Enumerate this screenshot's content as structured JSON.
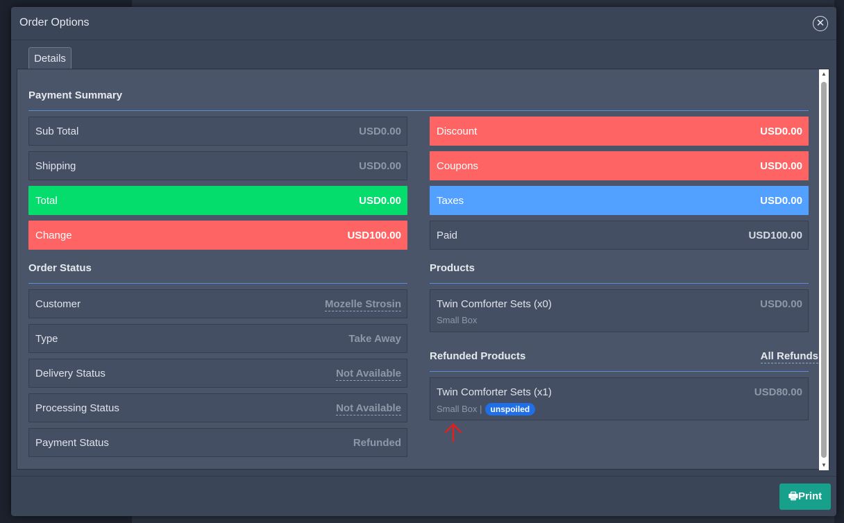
{
  "modal": {
    "title": "Order Options",
    "tab": "Details",
    "print_label": "Print"
  },
  "payment_summary": {
    "title": "Payment Summary",
    "left": [
      {
        "label": "Sub Total",
        "value": "USD0.00"
      },
      {
        "label": "Shipping",
        "value": "USD0.00"
      },
      {
        "label": "Total",
        "value": "USD0.00"
      },
      {
        "label": "Change",
        "value": "USD100.00"
      }
    ],
    "right": [
      {
        "label": "Discount",
        "value": "USD0.00"
      },
      {
        "label": "Coupons",
        "value": "USD0.00"
      },
      {
        "label": "Taxes",
        "value": "USD0.00"
      },
      {
        "label": "Paid",
        "value": "USD100.00"
      }
    ]
  },
  "order_status": {
    "title": "Order Status",
    "rows": [
      {
        "label": "Customer",
        "value": "Mozelle Strosin"
      },
      {
        "label": "Type",
        "value": "Take Away"
      },
      {
        "label": "Delivery Status",
        "value": "Not Available"
      },
      {
        "label": "Processing Status",
        "value": "Not Available"
      },
      {
        "label": "Payment Status",
        "value": "Refunded"
      }
    ]
  },
  "products": {
    "title": "Products",
    "items": [
      {
        "name": "Twin Comforter Sets (x0)",
        "unit": "Small Box",
        "price": "USD0.00"
      }
    ]
  },
  "refunded_products": {
    "title": "Refunded Products",
    "all_refunds": "All Refunds",
    "items": [
      {
        "name": "Twin Comforter Sets (x1)",
        "unit": "Small Box",
        "separator": "|",
        "badge": "unspoiled",
        "price": "USD80.00"
      }
    ]
  },
  "colors": {
    "red": "#ff6464",
    "green": "#04dc6c",
    "blue": "#52a0ff",
    "accent_line": "#5d8de0",
    "print_button": "#17a08c",
    "badge": "#1f6fe8"
  }
}
